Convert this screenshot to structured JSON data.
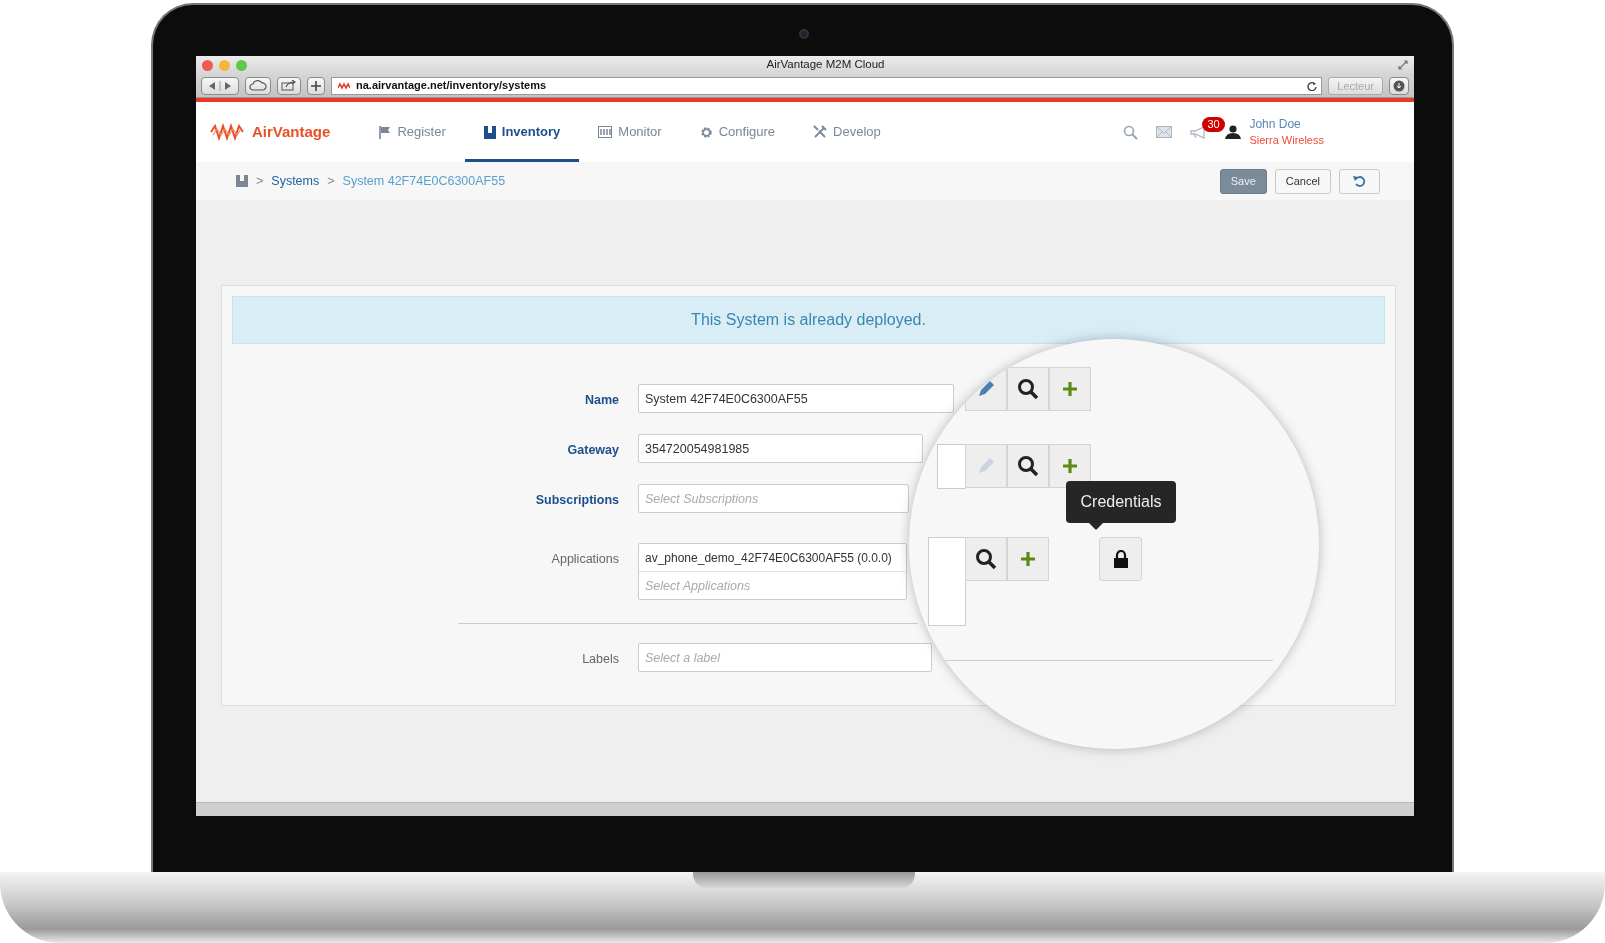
{
  "window": {
    "title": "AirVantage M2M Cloud"
  },
  "browser": {
    "url": "na.airvantage.net/inventory/systems",
    "reader_button": "Lecteur"
  },
  "app": {
    "brand": "AirVantage",
    "nav": [
      {
        "label": "Register",
        "selected": false
      },
      {
        "label": "Inventory",
        "selected": true
      },
      {
        "label": "Monitor",
        "selected": false
      },
      {
        "label": "Configure",
        "selected": false
      },
      {
        "label": "Develop",
        "selected": false
      }
    ],
    "notification_count": "30",
    "user": {
      "name": "John Doe",
      "company": "Sierra Wireless"
    }
  },
  "breadcrumb": {
    "separator": ">",
    "items": [
      "Systems",
      "System 42F74E0C6300AF55"
    ]
  },
  "actions": [
    {
      "label": "Save",
      "kind": "primary"
    },
    {
      "label": "Cancel",
      "kind": "default"
    }
  ],
  "alert": "This System is already deployed.",
  "form": {
    "fields": [
      {
        "label": "Name",
        "required": true,
        "value": "System 42F74E0C6300AF55"
      },
      {
        "label": "Gateway",
        "required": true,
        "value": "354720054981985"
      },
      {
        "label": "Subscriptions",
        "required": true,
        "placeholder": "Select Subscriptions"
      },
      {
        "label": "Applications",
        "required": false,
        "value": "av_phone_demo_42F74E0C6300AF55 (0.0.0)",
        "placeholder": "Select Applications"
      },
      {
        "label": "Labels",
        "required": false,
        "placeholder": "Select a label"
      }
    ]
  },
  "magnifier": {
    "tooltip": "Credentials",
    "edit_buttons": [
      {
        "disabled": false
      },
      {
        "disabled": true
      }
    ]
  }
}
